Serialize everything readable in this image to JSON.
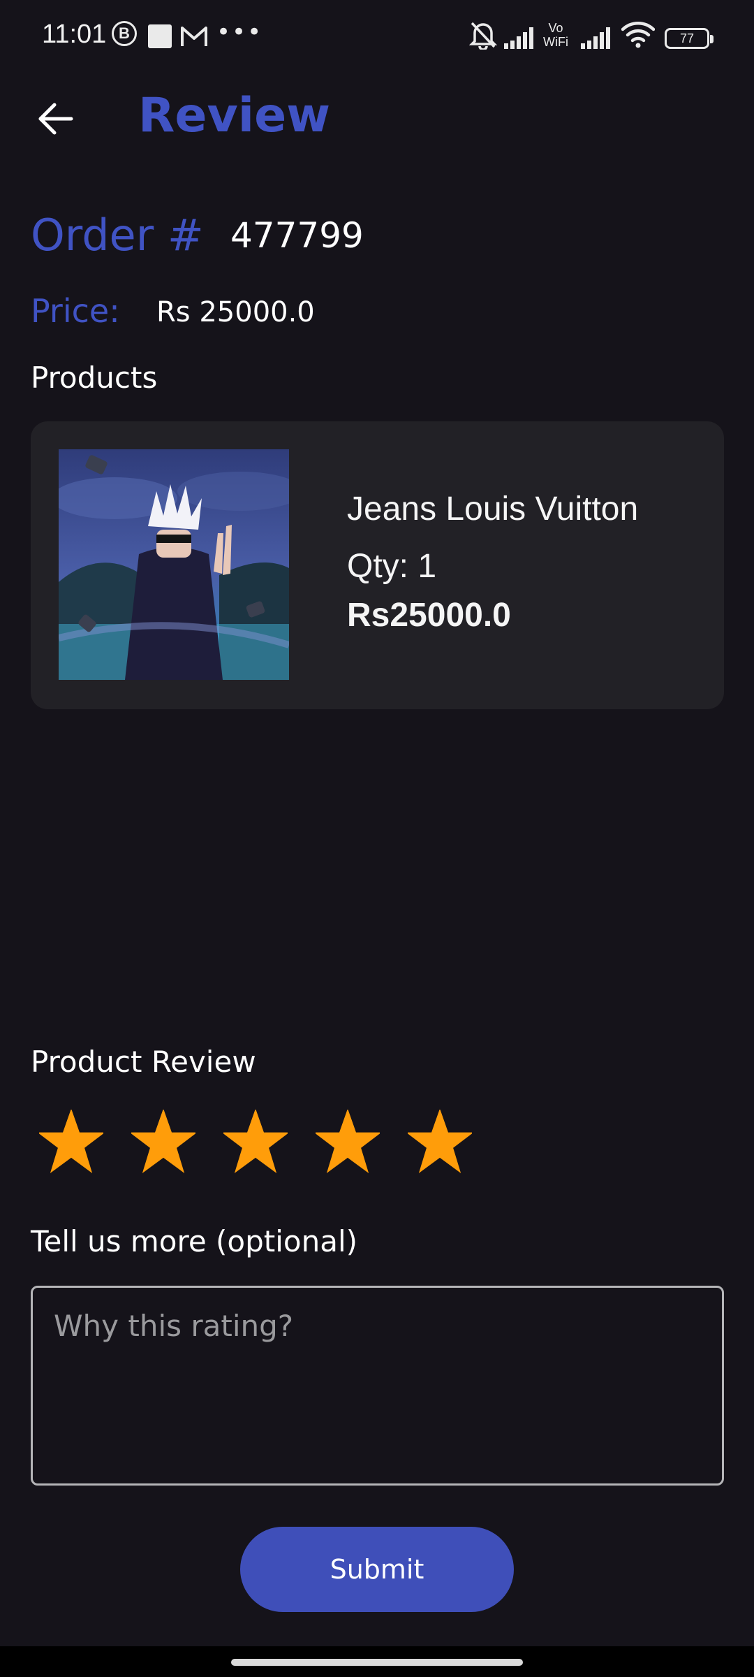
{
  "status_bar": {
    "time": "11:01",
    "b_icon": "B",
    "wifi_label_top": "Vo",
    "wifi_label_bottom": "WiFi",
    "battery": "77"
  },
  "header": {
    "title": "Review"
  },
  "order": {
    "label": "Order #",
    "number": "477799",
    "price_label": "Price:",
    "price_value": "Rs 25000.0"
  },
  "products": {
    "heading": "Products",
    "items": [
      {
        "name": "Jeans Louis Vuitton",
        "qty": "Qty: 1",
        "price": "Rs25000.0"
      }
    ]
  },
  "review": {
    "heading": "Product Review",
    "rating": 5,
    "max_rating": 5,
    "star_color": "#ff9d0a",
    "more_heading": "Tell us more (optional)",
    "placeholder": "Why this rating?",
    "submit_label": "Submit"
  },
  "colors": {
    "accent": "#4053c4",
    "background": "#15131a",
    "card": "#222126"
  }
}
